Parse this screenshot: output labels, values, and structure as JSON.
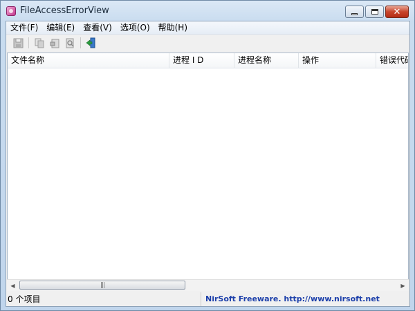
{
  "window": {
    "title": "FileAccessErrorView",
    "app_icon": "nirsoft-app-icon"
  },
  "menu": {
    "items": [
      "文件(F)",
      "编辑(E)",
      "查看(V)",
      "选项(O)",
      "帮助(H)"
    ]
  },
  "toolbar": {
    "buttons": [
      "save-icon",
      "copy-icon",
      "html-report-icon",
      "find-icon",
      "exit-icon"
    ]
  },
  "table": {
    "columns": [
      "文件名称",
      "进程 I D",
      "进程名称",
      "操作",
      "错误代码"
    ],
    "rows": []
  },
  "status": {
    "item_count": "0 个项目",
    "credit": "NirSoft Freeware.  http://www.nirsoft.net"
  },
  "colors": {
    "link": "#1c3faa",
    "close_button": "#c7452c"
  }
}
